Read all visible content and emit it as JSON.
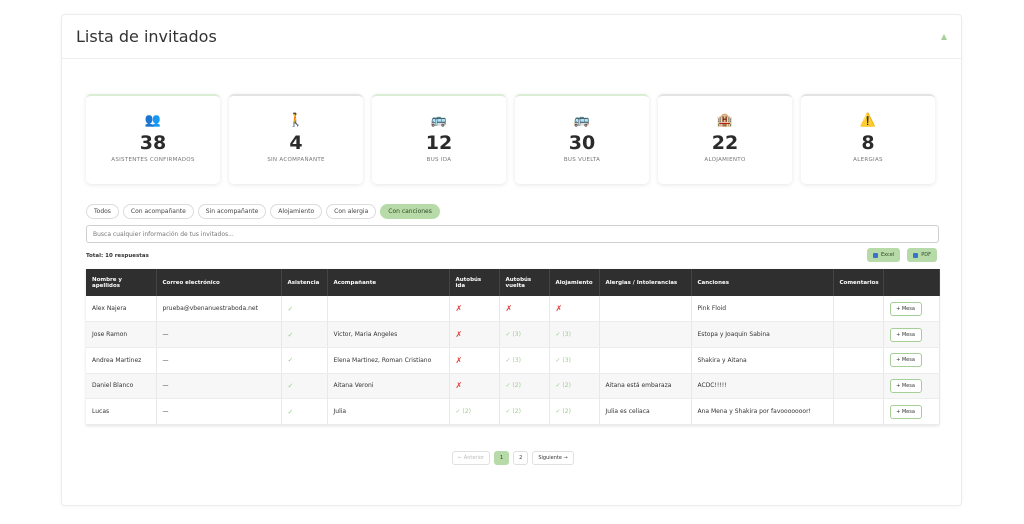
{
  "header": {
    "title": "Lista de invitados"
  },
  "stats": [
    {
      "icon": "👥",
      "icon_name": "group-icon",
      "value": "38",
      "label": "ASISTENTES CONFIRMADOS"
    },
    {
      "icon": "🚶",
      "icon_name": "walking-person-icon",
      "value": "4",
      "label": "SIN ACOMPAÑANTE"
    },
    {
      "icon": "🚌",
      "icon_name": "bus-icon",
      "value": "12",
      "label": "BUS IDA"
    },
    {
      "icon": "🚌",
      "icon_name": "bus-icon",
      "value": "30",
      "label": "BUS VUELTA"
    },
    {
      "icon": "🏨",
      "icon_name": "hotel-icon",
      "value": "22",
      "label": "ALOJAMIENTO"
    },
    {
      "icon": "⚠️",
      "icon_name": "warning-icon",
      "value": "8",
      "label": "ALERGIAS"
    }
  ],
  "filters": [
    {
      "label": "Todos",
      "active": false
    },
    {
      "label": "Con acompañante",
      "active": false
    },
    {
      "label": "Sin acompañante",
      "active": false
    },
    {
      "label": "Alojamiento",
      "active": false
    },
    {
      "label": "Con alergia",
      "active": false
    },
    {
      "label": "Con canciones",
      "active": true
    }
  ],
  "search": {
    "placeholder": "Busca cualquier información de tus invitados..."
  },
  "total": "Total: 10 respuestas",
  "exports": {
    "excel": "Excel",
    "pdf": "PDF"
  },
  "table": {
    "columns": [
      "Nombre y apellidos",
      "Correo electrónico",
      "Asistencia",
      "Acompañante",
      "Autobús ida",
      "Autobús vuelta",
      "Alojamiento",
      "Alergias / Intolerancias",
      "Canciones",
      "Comentarios",
      ""
    ],
    "rows": [
      {
        "name": "Alex Najera",
        "email": "prueba@vbenanuestraboda.net",
        "attendance": "✓",
        "companion": "",
        "bus_ida": "✗",
        "bus_vuelta": "✗",
        "alojamiento": "✗",
        "alergias": "",
        "canciones": "Pink Floid",
        "comentarios": ""
      },
      {
        "name": "Jose Ramon",
        "email": "—",
        "attendance": "✓",
        "companion": "Victor, Maria Angeles",
        "bus_ida": "✗",
        "bus_vuelta": "✓ (3)",
        "alojamiento": "✓ (3)",
        "alergias": "",
        "canciones": "Estopa y Joaquin Sabina",
        "comentarios": ""
      },
      {
        "name": "Andrea Martinez",
        "email": "—",
        "attendance": "✓",
        "companion": "Elena Martinez, Roman Cristiano",
        "bus_ida": "✗",
        "bus_vuelta": "✓ (3)",
        "alojamiento": "✓ (3)",
        "alergias": "",
        "canciones": "Shakira y Aitana",
        "comentarios": ""
      },
      {
        "name": "Daniel Blanco",
        "email": "—",
        "attendance": "✓",
        "companion": "Aitana Veroni",
        "bus_ida": "✗",
        "bus_vuelta": "✓ (2)",
        "alojamiento": "✓ (2)",
        "alergias": "Aitana está embaraza",
        "canciones": "ACDC!!!!!",
        "comentarios": ""
      },
      {
        "name": "Lucas",
        "email": "—",
        "attendance": "✓",
        "companion": "Julia",
        "bus_ida": "✓ (2)",
        "bus_vuelta": "✓ (2)",
        "alojamiento": "✓ (2)",
        "alergias": "Julia es celiaca",
        "canciones": "Ana Mena y Shakira por favooooooor!",
        "comentarios": ""
      }
    ],
    "row_button": "+ Mesa"
  },
  "pagination": {
    "prev": "← Anterior",
    "pages": [
      "1",
      "2"
    ],
    "current": "1",
    "next": "Siguiente →"
  }
}
